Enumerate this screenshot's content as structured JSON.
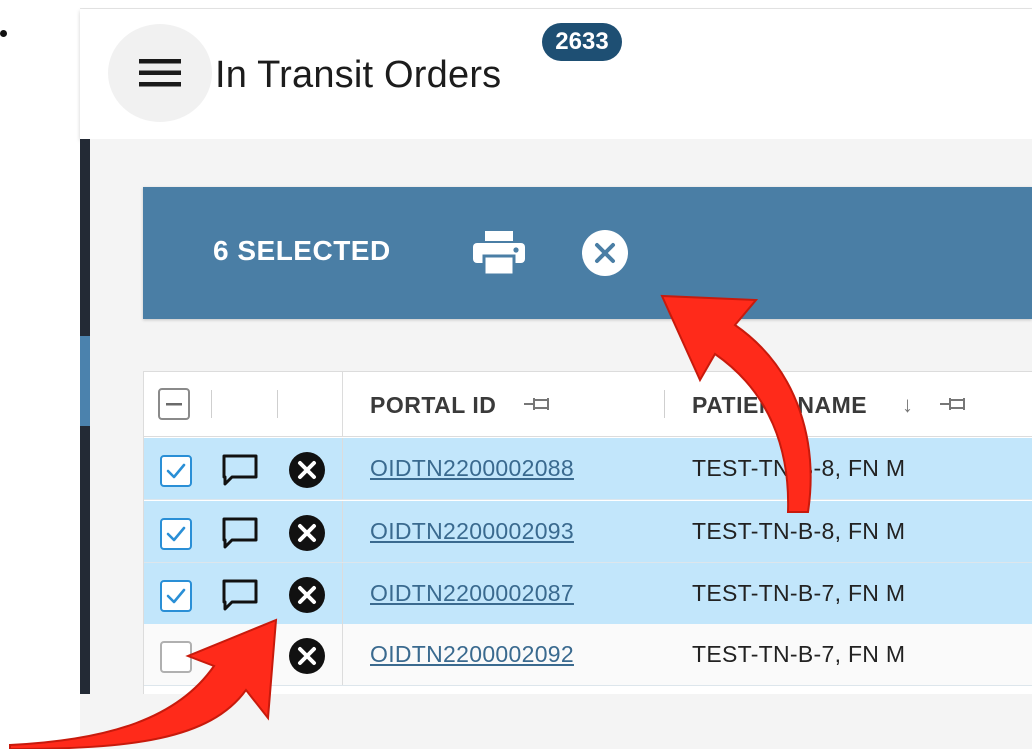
{
  "header": {
    "title": "In Transit Orders",
    "count_badge": "2633"
  },
  "selection_bar": {
    "selected_label": "6 SELECTED",
    "bar_color": "#4a7ea5"
  },
  "table": {
    "columns": [
      {
        "label": "PORTAL ID",
        "pinned": true
      },
      {
        "label": "PATIENT NAME",
        "sorted": "descending",
        "pinned": true
      }
    ],
    "rows": [
      {
        "portal_id": "OIDTN2200002088",
        "patient_name": "TEST-TN-B-8, FN M",
        "checked": true
      },
      {
        "portal_id": "OIDTN2200002093",
        "patient_name": "TEST-TN-B-8, FN M",
        "checked": true
      },
      {
        "portal_id": "OIDTN2200002087",
        "patient_name": "TEST-TN-B-7, FN M",
        "checked": true
      },
      {
        "portal_id": "OIDTN2200002092",
        "patient_name": "TEST-TN-B-7, FN M",
        "checked": false
      }
    ]
  },
  "icons": {
    "menu": "hamburger-menu-icon",
    "print": "printer-icon",
    "clear_selection": "close-circle-icon",
    "comment": "comment-icon",
    "cancel_row": "cancel-circle-icon",
    "pin": "pin-icon",
    "sort": "sort-down-arrow-icon"
  },
  "colors": {
    "selected_row": "#c2e6fb",
    "badge": "#1e4f73",
    "annotation_arrow": "#ff2a1a",
    "link": "#3a6a8f"
  }
}
